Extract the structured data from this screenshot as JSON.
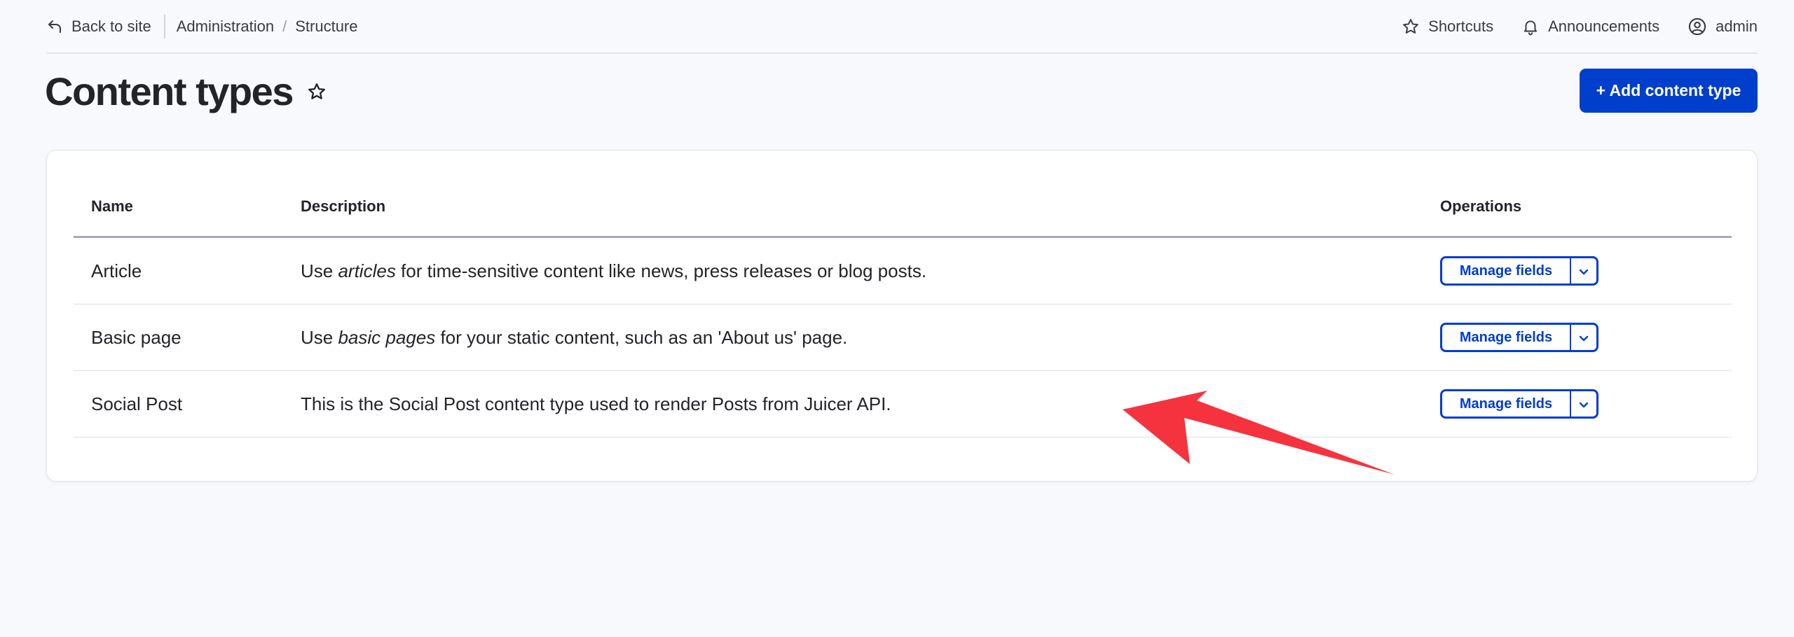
{
  "toolbar": {
    "back_label": "Back to site",
    "breadcrumb": [
      "Administration",
      "Structure"
    ],
    "breadcrumb_separator": "/",
    "shortcuts_label": "Shortcuts",
    "announcements_label": "Announcements",
    "user_label": "admin"
  },
  "page": {
    "title": "Content types",
    "add_button_label": "+ Add content type"
  },
  "table": {
    "headers": {
      "name": "Name",
      "description": "Description",
      "operations": "Operations"
    },
    "rows": [
      {
        "name": "Article",
        "desc_before": "Use ",
        "desc_em": "articles",
        "desc_after": " for time-sensitive content like news, press releases or blog posts.",
        "action_label": "Manage fields"
      },
      {
        "name": "Basic page",
        "desc_before": "Use ",
        "desc_em": "basic pages",
        "desc_after": " for your static content, such as an 'About us' page.",
        "action_label": "Manage fields"
      },
      {
        "name": "Social Post",
        "desc_before": "This is the Social Post content type used to render Posts from Juicer API.",
        "desc_em": "",
        "desc_after": "",
        "action_label": "Manage fields"
      }
    ]
  },
  "colors": {
    "primary": "#003ecc",
    "background": "#f8f9fc",
    "annotation_arrow": "#f5333f"
  },
  "icons": {
    "back": "back-arrow-icon",
    "shortcuts": "star-icon",
    "announcements": "bell-icon",
    "user": "user-circle-icon",
    "favorite": "star-outline-icon",
    "dropdown": "chevron-down-icon"
  }
}
